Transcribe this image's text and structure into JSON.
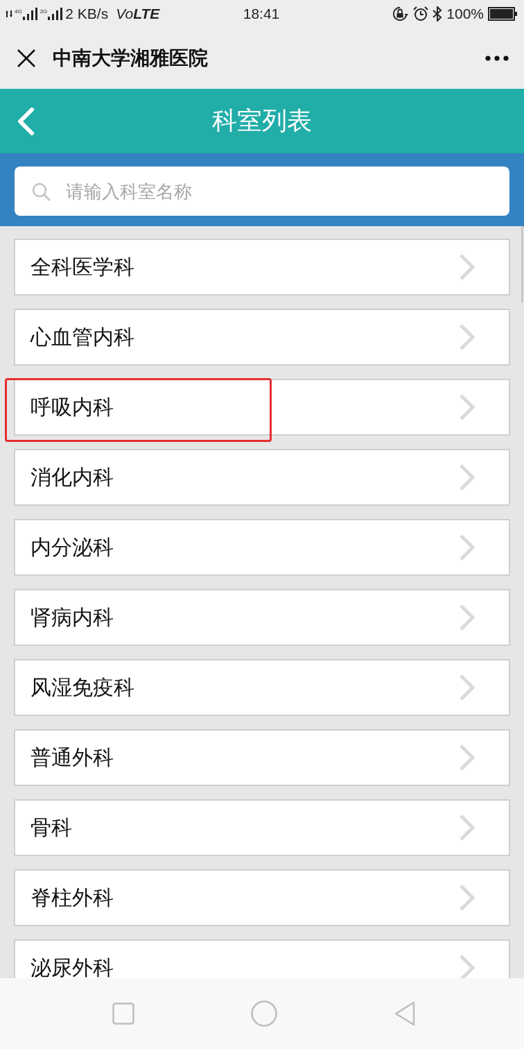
{
  "status_bar": {
    "network_1": "4G",
    "network_2": "2G",
    "speed": "2 KB/s",
    "volte": "Vo**LTE**",
    "time": "18:41",
    "battery": "100%"
  },
  "title_bar": {
    "title": "中南大学湘雅医院"
  },
  "header": {
    "title": "科室列表"
  },
  "search": {
    "placeholder": "请输入科室名称"
  },
  "departments": [
    {
      "name": "全科医学科",
      "highlighted": false
    },
    {
      "name": "心血管内科",
      "highlighted": false
    },
    {
      "name": "呼吸内科",
      "highlighted": true
    },
    {
      "name": "消化内科",
      "highlighted": false
    },
    {
      "name": "内分泌科",
      "highlighted": false
    },
    {
      "name": "肾病内科",
      "highlighted": false
    },
    {
      "name": "风湿免疫科",
      "highlighted": false
    },
    {
      "name": "普通外科",
      "highlighted": false
    },
    {
      "name": "骨科",
      "highlighted": false
    },
    {
      "name": "脊柱外科",
      "highlighted": false
    },
    {
      "name": "泌尿外科",
      "highlighted": false
    }
  ]
}
